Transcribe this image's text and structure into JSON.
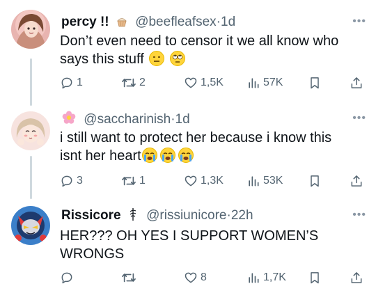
{
  "tweets": [
    {
      "display_name": "percy !!",
      "handle": "@beefleafsex",
      "time": "1d",
      "text_lines": [
        "Don’t even need to censor it we all know who",
        "says this stuff"
      ],
      "emojis": [
        "expressionless-face",
        "face-with-rolling-eyes"
      ],
      "replies": "1",
      "retweets": "2",
      "likes": "1,5K",
      "views": "57K"
    },
    {
      "display_name": "",
      "handle": "@saccharinish",
      "time": "1d",
      "text_lines": [
        "i still want to protect her because i know this",
        "isnt her heart"
      ],
      "emojis": [
        "crying-face",
        "crying-face",
        "crying-face"
      ],
      "replies": "3",
      "retweets": "1",
      "likes": "1,3K",
      "views": "53K"
    },
    {
      "display_name": "Rissicore",
      "handle": "@rissiunicore",
      "time": "22h",
      "text_lines": [
        "HER??? OH YES I SUPPORT WOMEN’S",
        "WRONGS"
      ],
      "emojis": [],
      "replies": "",
      "retweets": "",
      "likes": "8",
      "views": "1,7K"
    }
  ],
  "separator": "·",
  "more_icon": "more-icon",
  "colors": {
    "text": "#0f1419",
    "secondary": "#536471",
    "thread_line": "#cfd9de"
  }
}
